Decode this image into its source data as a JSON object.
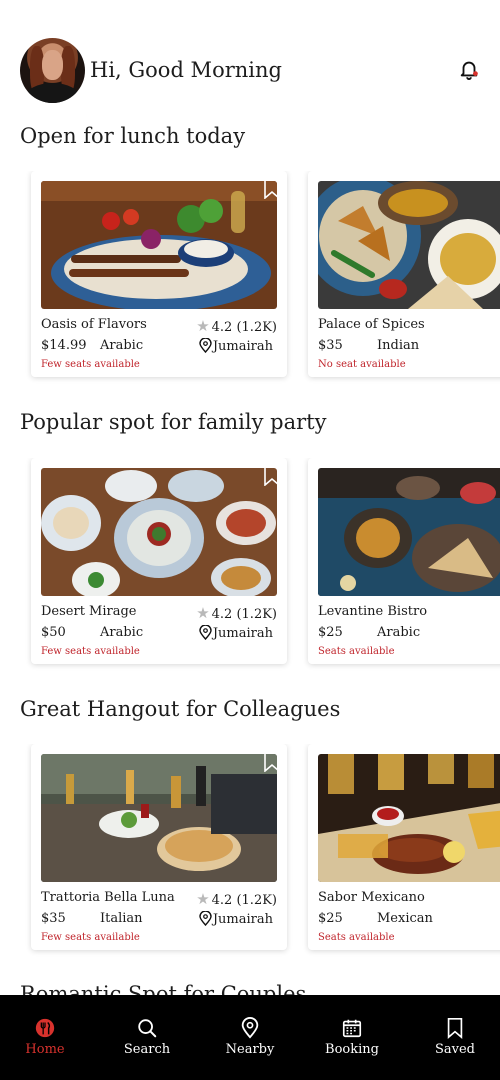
{
  "header": {
    "greeting": "Hi, Good Morning"
  },
  "sections": [
    {
      "title": "Open for lunch today",
      "cards": [
        {
          "name": "Oasis of Flavors",
          "rating": "4.2 (1.2K)",
          "price": "$14.99",
          "cuisine": "Arabic",
          "location": "Jumairah",
          "seats": "Few seats available"
        },
        {
          "name": "Palace of Spices",
          "price": "$35",
          "cuisine": "Indian",
          "seats": "No seat available"
        }
      ]
    },
    {
      "title": "Popular spot for family party",
      "cards": [
        {
          "name": "Desert Mirage",
          "rating": "4.2 (1.2K)",
          "price": "$50",
          "cuisine": "Arabic",
          "location": "Jumairah",
          "seats": "Few seats available"
        },
        {
          "name": "Levantine Bistro",
          "price": "$25",
          "cuisine": "Arabic",
          "seats": "Seats available"
        }
      ]
    },
    {
      "title": "Great Hangout for Colleagues",
      "cards": [
        {
          "name": "Trattoria Bella Luna",
          "rating": "4.2 (1.2K)",
          "price": "$35",
          "cuisine": "Italian",
          "location": "Jumairah",
          "seats": "Few seats available"
        },
        {
          "name": "Sabor Mexicano",
          "price": "$25",
          "cuisine": "Mexican",
          "seats": "Seats available"
        }
      ]
    },
    {
      "title": "Romantic Spot for Couples"
    }
  ],
  "nav": {
    "items": [
      {
        "label": "Home",
        "icon": "home-icon",
        "active": true
      },
      {
        "label": "Search",
        "icon": "search-icon"
      },
      {
        "label": "Nearby",
        "icon": "location-pin-icon"
      },
      {
        "label": "Booking",
        "icon": "calendar-icon"
      },
      {
        "label": "Saved",
        "icon": "bookmark-icon"
      }
    ]
  },
  "colors": {
    "accent": "#d8322d",
    "seats_text": "#c0262d",
    "nav_bg": "#000000"
  }
}
